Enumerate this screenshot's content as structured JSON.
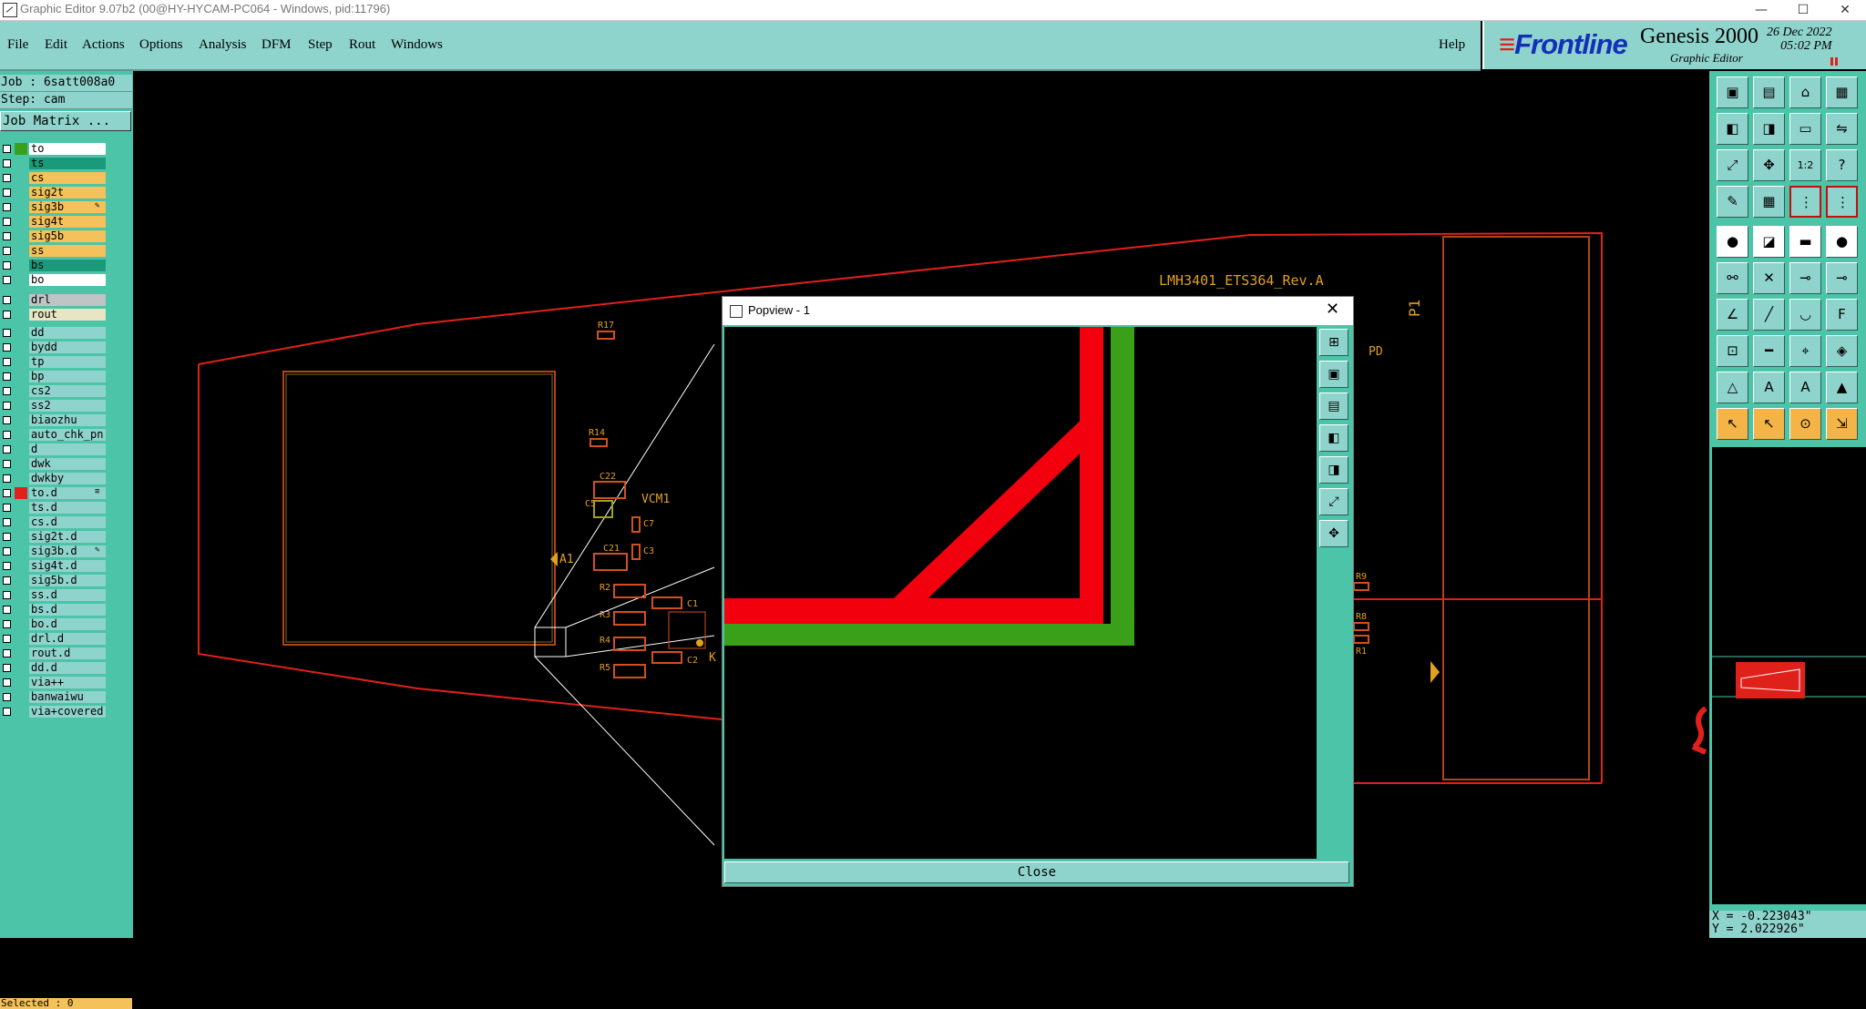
{
  "window": {
    "title": "Graphic Editor 9.07b2 (00@HY-HYCAM-PC064 - Windows, pid:11796)",
    "minimize": "—",
    "maximize": "☐",
    "close": "✕"
  },
  "menu": [
    "File",
    "Edit",
    "Actions",
    "Options",
    "Analysis",
    "DFM",
    "Step",
    "Rout",
    "Windows"
  ],
  "help": "Help",
  "brand": {
    "logo": "Frontline",
    "product": "Genesis 2000",
    "subtitle": "Graphic Editor",
    "date": "26 Dec 2022",
    "time": "05:02 PM"
  },
  "job": {
    "job_line": "Job : 6satt008a0",
    "step_line": "Step: cam",
    "matrix_button": "Job Matrix ..."
  },
  "layers_board": [
    {
      "name": "to",
      "color": "#ffffff",
      "swatch": "#3aa01a",
      "mark": ""
    },
    {
      "name": "ts",
      "color": "#1a9a7a",
      "swatch": "",
      "mark": ""
    },
    {
      "name": "cs",
      "color": "#f4c15a",
      "swatch": "",
      "mark": ""
    },
    {
      "name": "sig2t",
      "color": "#f4c15a",
      "swatch": "",
      "mark": ""
    },
    {
      "name": "sig3b",
      "color": "#f4c15a",
      "swatch": "",
      "mark": "✎"
    },
    {
      "name": "sig4t",
      "color": "#f4c15a",
      "swatch": "",
      "mark": ""
    },
    {
      "name": "sig5b",
      "color": "#f4c15a",
      "swatch": "",
      "mark": ""
    },
    {
      "name": "ss",
      "color": "#f4c15a",
      "swatch": "",
      "mark": ""
    },
    {
      "name": "bs",
      "color": "#1a9a7a",
      "swatch": "",
      "mark": ""
    },
    {
      "name": "bo",
      "color": "#ffffff",
      "swatch": "",
      "mark": ""
    }
  ],
  "layers_drill": [
    {
      "name": "drl",
      "color": "#bfc4c4"
    },
    {
      "name": "rout",
      "color": "#e8e4c4"
    }
  ],
  "layers_misc": [
    {
      "name": "dd",
      "mark": "",
      "swatch": ""
    },
    {
      "name": "bydd",
      "mark": "",
      "swatch": ""
    },
    {
      "name": "tp",
      "mark": "",
      "swatch": ""
    },
    {
      "name": "bp",
      "mark": "",
      "swatch": ""
    },
    {
      "name": "cs2",
      "mark": "",
      "swatch": ""
    },
    {
      "name": "ss2",
      "mark": "",
      "swatch": ""
    },
    {
      "name": "biaozhu",
      "mark": "",
      "swatch": ""
    },
    {
      "name": "auto_chk_pn",
      "mark": "",
      "swatch": ""
    },
    {
      "name": "d",
      "mark": "",
      "swatch": ""
    },
    {
      "name": "dwk",
      "mark": "",
      "swatch": ""
    },
    {
      "name": "dwkby",
      "mark": "",
      "swatch": ""
    },
    {
      "name": "to.d",
      "mark": "≡",
      "swatch": "#e0201a"
    },
    {
      "name": "ts.d",
      "mark": "",
      "swatch": ""
    },
    {
      "name": "cs.d",
      "mark": "",
      "swatch": ""
    },
    {
      "name": "sig2t.d",
      "mark": "",
      "swatch": ""
    },
    {
      "name": "sig3b.d",
      "mark": "✎",
      "swatch": ""
    },
    {
      "name": "sig4t.d",
      "mark": "",
      "swatch": ""
    },
    {
      "name": "sig5b.d",
      "mark": "",
      "swatch": ""
    },
    {
      "name": "ss.d",
      "mark": "",
      "swatch": ""
    },
    {
      "name": "bs.d",
      "mark": "",
      "swatch": ""
    },
    {
      "name": "bo.d",
      "mark": "",
      "swatch": ""
    },
    {
      "name": "drl.d",
      "mark": "",
      "swatch": ""
    },
    {
      "name": "rout.d",
      "mark": "",
      "swatch": ""
    },
    {
      "name": "dd.d",
      "mark": "",
      "swatch": ""
    },
    {
      "name": "via++",
      "mark": "",
      "swatch": ""
    },
    {
      "name": "banwaiwu",
      "mark": "",
      "swatch": ""
    },
    {
      "name": "via+covered",
      "mark": "",
      "swatch": ""
    }
  ],
  "selected": "Selected : 0",
  "canvas": {
    "board_title": "LMH3401_ETS364_Rev.A",
    "labels": [
      "R17",
      "R14",
      "C22",
      "VCM1",
      "C5",
      "C7",
      "C21",
      "C3",
      "C1",
      "R2",
      "R3",
      "R4",
      "R5",
      "C2",
      "K",
      "A1",
      "PD",
      "P1",
      "R9",
      "R8",
      "R1"
    ]
  },
  "toolbox_icons": [
    "open-icon",
    "save-icon",
    "home-icon",
    "window-icon",
    "pan-left-icon",
    "pan-right-icon",
    "snap-icon",
    "swap-icon",
    "zoom-fit-icon",
    "zoom-center-icon",
    "scale-1-2-icon",
    "help-icon",
    "script-icon",
    "grid-icon",
    "measure-icon",
    "measure-alt-icon",
    "add-feature-icon",
    "line-icon",
    "ruler-icon",
    "pad-icon",
    "connect-icon",
    "cross-icon",
    "move-node-icon",
    "split-icon",
    "draw-line-icon",
    "slash-icon",
    "arc-icon",
    "text-icon",
    "node-box-icon",
    "minus-icon",
    "center-icon",
    "copy-icon",
    "triangle-icon",
    "triangle-a-icon",
    "triangle-b-icon",
    "triangle-up-icon",
    "select-icon",
    "select-box-icon",
    "select-circle-icon",
    "select-poly-icon"
  ],
  "coords": {
    "x": "X = -0.223043\"",
    "y": "Y = 2.022926\""
  },
  "popup": {
    "title": "Popview - 1",
    "close_x": "✕",
    "close_label": "Close",
    "tools": [
      "zoom-in-icon",
      "zoom-out-icon",
      "pan-icon",
      "left-icon",
      "right-icon",
      "fit-icon",
      "center-icon"
    ]
  }
}
